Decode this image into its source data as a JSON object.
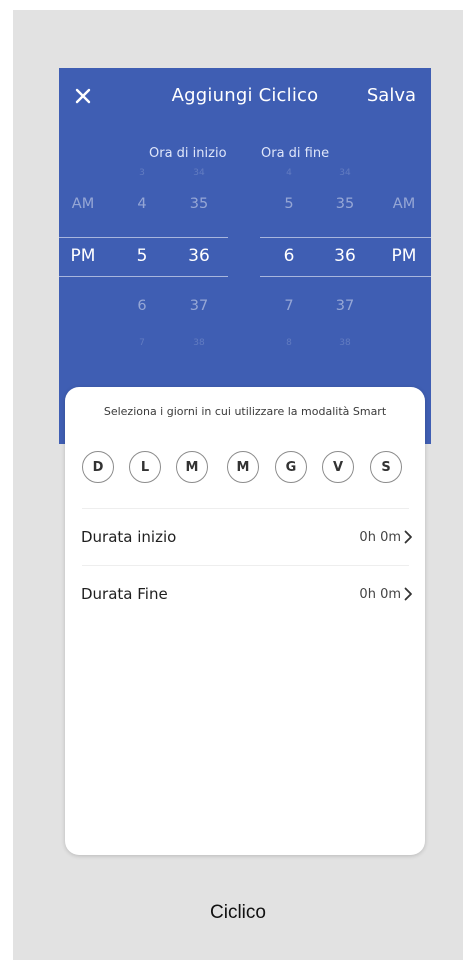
{
  "header": {
    "title": "Aggiungi Ciclico",
    "save_label": "Salva",
    "close_icon": "close-icon"
  },
  "picker": {
    "start_label": "Ora di inizio",
    "end_label": "Ora di fine",
    "start": {
      "ampm": [
        "AM",
        "PM"
      ],
      "hours": [
        "4",
        "5",
        "6"
      ],
      "minutes": [
        "35",
        "36",
        "37"
      ],
      "selected": {
        "ampm": "PM",
        "hour": "5",
        "minute": "36"
      }
    },
    "end": {
      "ampm": [
        "AM",
        "PM"
      ],
      "hours": [
        "5",
        "6",
        "7"
      ],
      "minutes": [
        "35",
        "36",
        "37"
      ],
      "selected": {
        "ampm": "PM",
        "hour": "6",
        "minute": "36"
      }
    }
  },
  "sheet": {
    "prompt": "Seleziona i giorni in cui utilizzare la modalità Smart",
    "days": [
      "D",
      "L",
      "M",
      "M",
      "G",
      "V",
      "S"
    ],
    "rows": [
      {
        "label": "Durata inizio",
        "value": "0h 0m"
      },
      {
        "label": "Durata Fine",
        "value": "0h 0m"
      }
    ]
  },
  "caption": "Ciclico",
  "colors": {
    "header_blue": "#3f5eb3",
    "background": "#e2e2e2",
    "sheet": "#ffffff"
  }
}
